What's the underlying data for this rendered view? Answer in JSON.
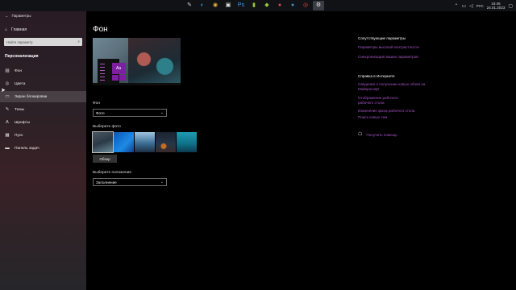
{
  "taskbar": {
    "apps": [
      {
        "name": "pen-icon",
        "glyph": "✎",
        "color": "#d0d0d0"
      },
      {
        "name": "edge-icon",
        "glyph": "◐",
        "color": "#34a3e0"
      },
      {
        "name": "chrome-icon",
        "glyph": "◉",
        "color": "#e9b533"
      },
      {
        "name": "store-icon",
        "glyph": "▣",
        "color": "#e0e0e0"
      },
      {
        "name": "photoshop-icon",
        "glyph": "Ps",
        "color": "#31a8ff"
      },
      {
        "name": "terminal-icon",
        "glyph": "▮",
        "color": "#9ac83d"
      },
      {
        "name": "bag-icon",
        "glyph": "◆",
        "color": "#9ac83d"
      },
      {
        "name": "game-icon",
        "glyph": "●",
        "color": "#e04848"
      },
      {
        "name": "steam-icon",
        "glyph": "●",
        "color": "#3d8fd0"
      },
      {
        "name": "spotify-icon",
        "glyph": "◎",
        "color": "#e04848"
      },
      {
        "name": "settings-icon",
        "glyph": "⚙",
        "color": "#f0f0f0"
      }
    ],
    "tray": {
      "lang": "РУС",
      "time": "16:46",
      "date": "24.01.2023"
    }
  },
  "sidebar": {
    "title": "Параметры",
    "home": "Главная",
    "search_placeholder": "Найти параметр",
    "section": "Персонализация",
    "items": [
      {
        "label": "Фон",
        "icon": "picture-icon",
        "glyph": "▨"
      },
      {
        "label": "Цвета",
        "icon": "palette-icon",
        "glyph": "◎"
      },
      {
        "label": "Экран блокировки",
        "icon": "lockscreen-icon",
        "glyph": "▭"
      },
      {
        "label": "Темы",
        "icon": "brush-icon",
        "glyph": "✎"
      },
      {
        "label": "Шрифты",
        "icon": "font-icon",
        "glyph": "A"
      },
      {
        "label": "Пуск",
        "icon": "start-icon",
        "glyph": "▦"
      },
      {
        "label": "Панель задач",
        "icon": "taskbar-icon",
        "glyph": "▬"
      }
    ]
  },
  "main": {
    "title": "Фон",
    "preview_tile": "Aa",
    "background_label": "Фон",
    "background_value": "Фото",
    "choose_photo_label": "Выберите фото",
    "browse_label": "Обзор",
    "fit_label": "Выберите положение",
    "fit_value": "Заполнение"
  },
  "right_panel": {
    "related_title": "Сопутствующие параметры",
    "related_links": [
      "Параметры высокой контрастности",
      "Синхронизация ваших параметров"
    ],
    "help_title": "Справка в Интернете",
    "help_links": [
      "Сведения о получении новых обоев на Майкрософт",
      "Отображение рабочего рабочего стола",
      "Изменение фона рабочего стола",
      "Поиск новых тем"
    ],
    "feedback": "Получить помощь"
  }
}
